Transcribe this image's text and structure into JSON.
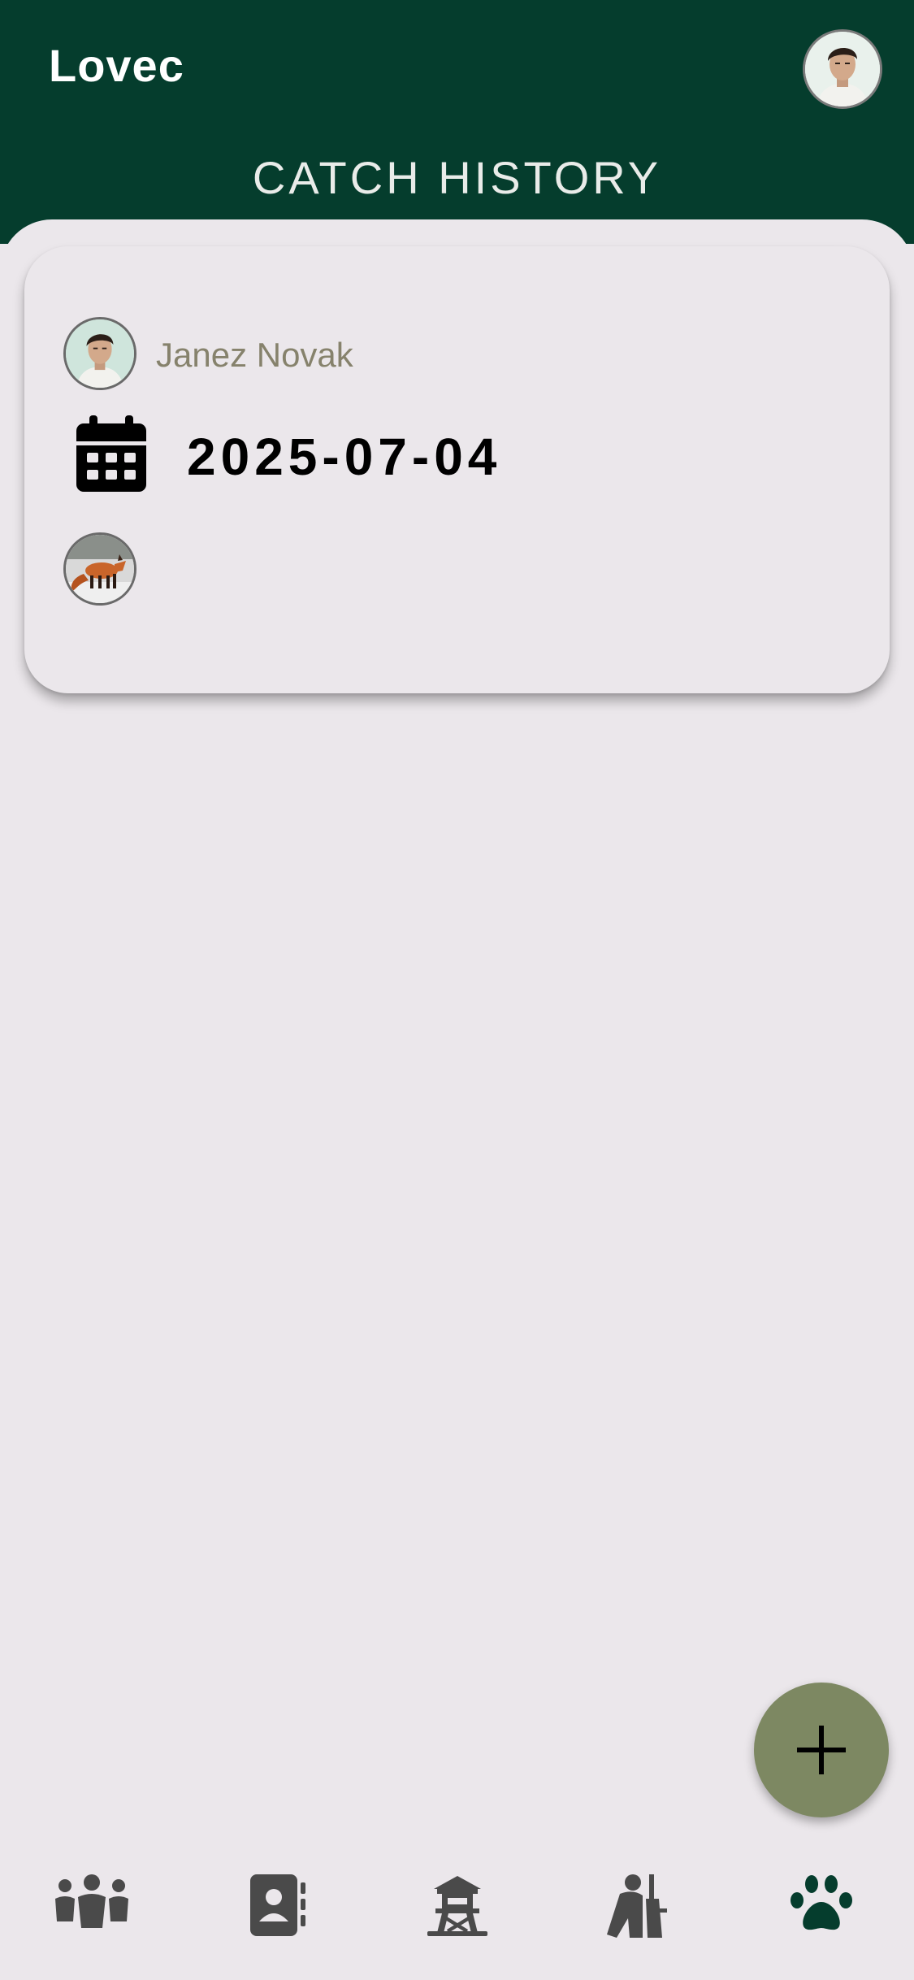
{
  "app": {
    "title": "Lovec"
  },
  "page": {
    "title": "CATCH HISTORY"
  },
  "catch_list": [
    {
      "user_name": "Janez Novak",
      "date": "2025-07-04",
      "animal_icon": "fox-photo"
    }
  ],
  "fab": {
    "icon": "plus-icon"
  },
  "bottom_nav": [
    {
      "icon": "group-icon",
      "active": false
    },
    {
      "icon": "contacts-icon",
      "active": false
    },
    {
      "icon": "watchtower-icon",
      "active": false
    },
    {
      "icon": "hunter-icon",
      "active": false
    },
    {
      "icon": "paw-icon",
      "active": true
    }
  ],
  "colors": {
    "header": "#053d2d",
    "background": "#ebe7eb",
    "fab": "#7d8862",
    "nav_inactive": "#4a4a4a",
    "nav_active": "#053d2d",
    "user_name": "#86826c"
  }
}
